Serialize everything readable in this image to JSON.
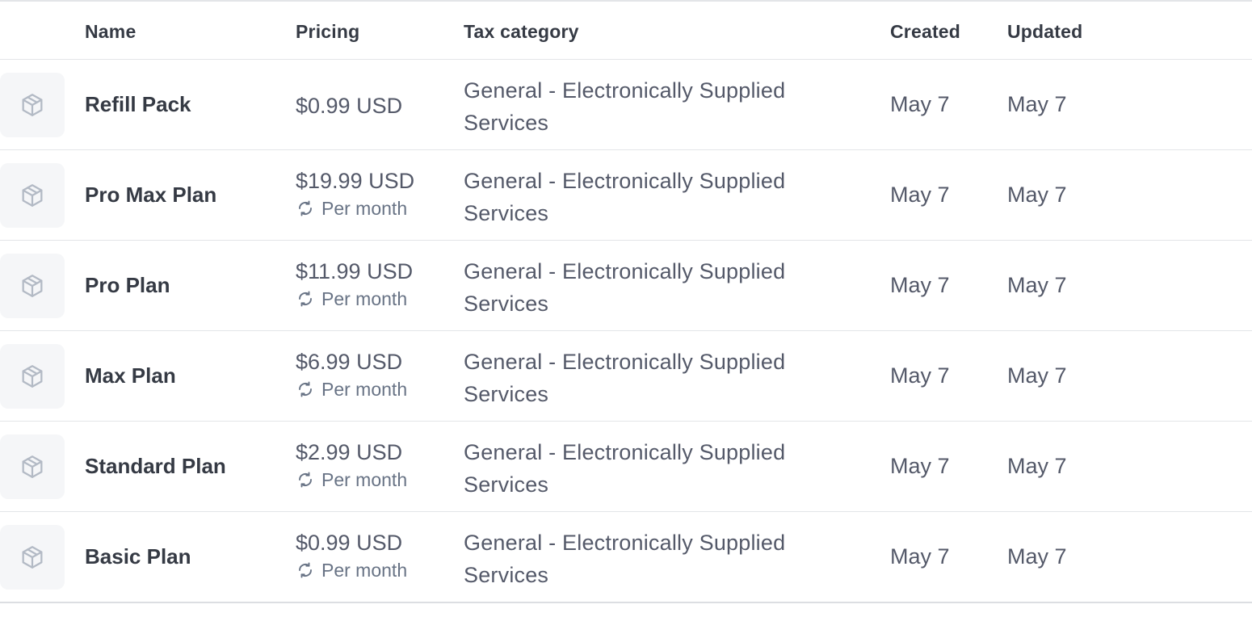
{
  "columns": {
    "name": "Name",
    "pricing": "Pricing",
    "tax_category": "Tax category",
    "created": "Created",
    "updated": "Updated"
  },
  "icons": {
    "product": "package-icon",
    "recurring": "refresh-icon"
  },
  "rows": [
    {
      "name": "Refill Pack",
      "price": "$0.99 USD",
      "interval": "",
      "tax": "General - Electronically Supplied Services",
      "created": "May 7",
      "updated": "May 7"
    },
    {
      "name": "Pro Max Plan",
      "price": "$19.99 USD",
      "interval": "Per month",
      "tax": "General - Electronically Supplied Services",
      "created": "May 7",
      "updated": "May 7"
    },
    {
      "name": "Pro Plan",
      "price": "$11.99 USD",
      "interval": "Per month",
      "tax": "General - Electronically Supplied Services",
      "created": "May 7",
      "updated": "May 7"
    },
    {
      "name": "Max Plan",
      "price": "$6.99 USD",
      "interval": "Per month",
      "tax": "General - Electronically Supplied Services",
      "created": "May 7",
      "updated": "May 7"
    },
    {
      "name": "Standard Plan",
      "price": "$2.99 USD",
      "interval": "Per month",
      "tax": "General - Electronically Supplied Services",
      "created": "May 7",
      "updated": "May 7"
    },
    {
      "name": "Basic Plan",
      "price": "$0.99 USD",
      "interval": "Per month",
      "tax": "General - Electronically Supplied Services",
      "created": "May 7",
      "updated": "May 7"
    }
  ]
}
